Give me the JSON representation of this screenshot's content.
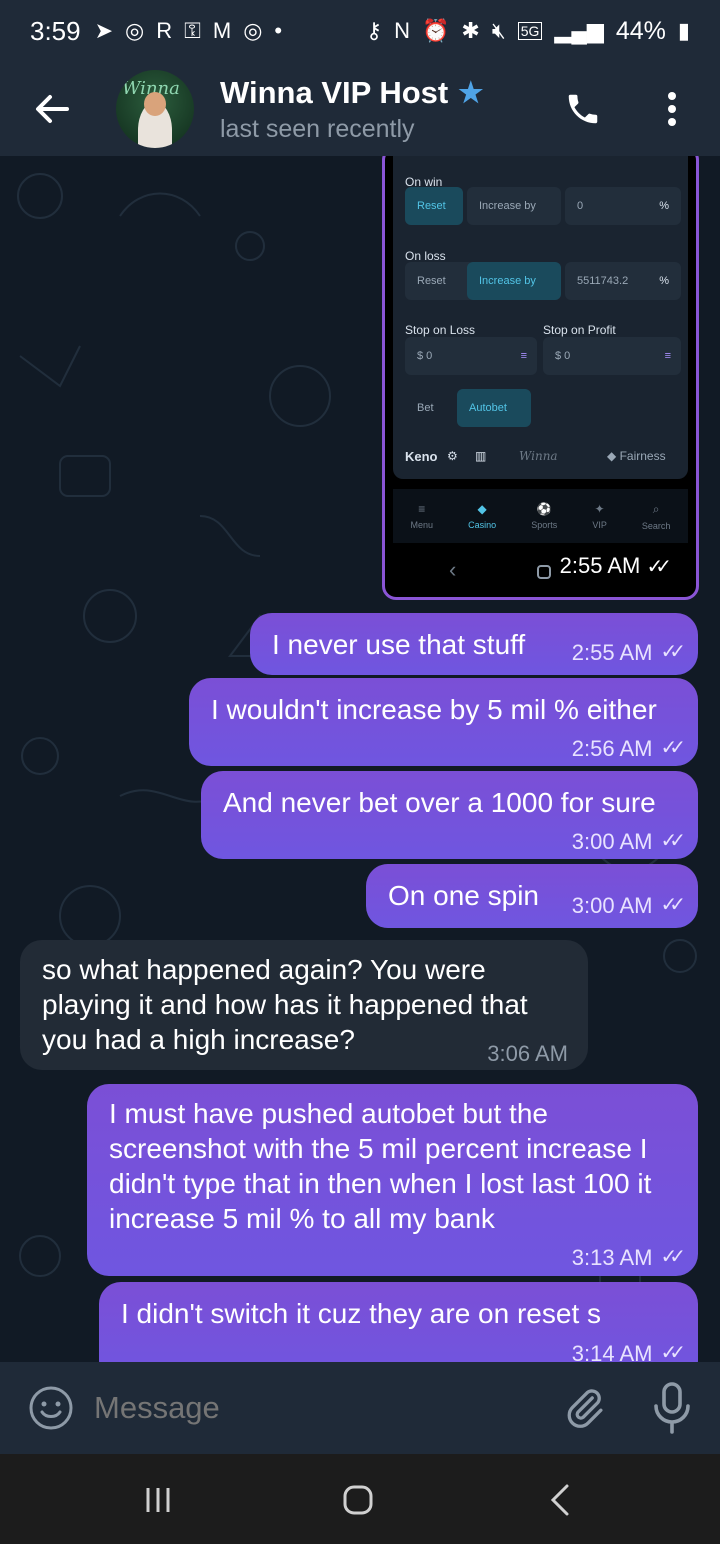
{
  "status_bar": {
    "time": "3:59",
    "battery": "44%",
    "network": "5G"
  },
  "header": {
    "contact_name": "Winna VIP Host",
    "contact_status": "last seen recently",
    "avatar_logo": "Winna"
  },
  "image_message": {
    "time": "2:55 AM",
    "screenshot": {
      "on_win_label": "On win",
      "on_win_reset": "Reset",
      "on_win_increase": "Increase by",
      "on_win_value": "0",
      "on_loss_label": "On loss",
      "on_loss_reset": "Reset",
      "on_loss_increase": "Increase by",
      "on_loss_value": "5511743.2",
      "pct": "%",
      "stop_loss_label": "Stop on Loss",
      "stop_profit_label": "Stop on Profit",
      "stop_loss_value": "$ 0",
      "stop_profit_value": "$ 0",
      "bet_tab": "Bet",
      "autobet_tab": "Autobet",
      "game_name": "Keno",
      "brand": "Winna",
      "fairness": "Fairness",
      "nav": [
        "Menu",
        "Casino",
        "Sports",
        "VIP",
        "Search"
      ]
    }
  },
  "messages": [
    {
      "dir": "out",
      "text": "I never use that stuff",
      "time": "2:55 AM"
    },
    {
      "dir": "out",
      "text": "I wouldn't increase by 5 mil % either",
      "time": "2:56 AM"
    },
    {
      "dir": "out",
      "text": "And never bet over a 1000 for sure",
      "time": "3:00 AM"
    },
    {
      "dir": "out",
      "text": "On one spin",
      "time": "3:00 AM"
    },
    {
      "dir": "in",
      "text": "so what happened again? You were playing it and how has it happened that you had a high increase?",
      "time": "3:06 AM"
    },
    {
      "dir": "out",
      "text": "I must have pushed autobet but the screenshot with the 5 mil percent increase I didn't type that in then when I lost last 100 it increase 5 mil % to all my bank",
      "time": "3:13 AM"
    },
    {
      "dir": "out",
      "text": "I didn't switch it cuz they are on reset s",
      "time": "3:14 AM"
    }
  ],
  "input": {
    "placeholder": "Message"
  },
  "colors": {
    "outgoing_bubble": "#7b4fd6",
    "incoming_bubble": "#222b36",
    "header": "#1f2a38",
    "chat_bg": "#111a25",
    "accent": "#4fa3e6"
  },
  "icons": [
    "back-arrow-icon",
    "verified-star-icon",
    "phone-icon",
    "more-vert-icon",
    "emoji-icon",
    "attach-icon",
    "mic-icon",
    "chevron-down-icon",
    "read-checks-icon"
  ]
}
